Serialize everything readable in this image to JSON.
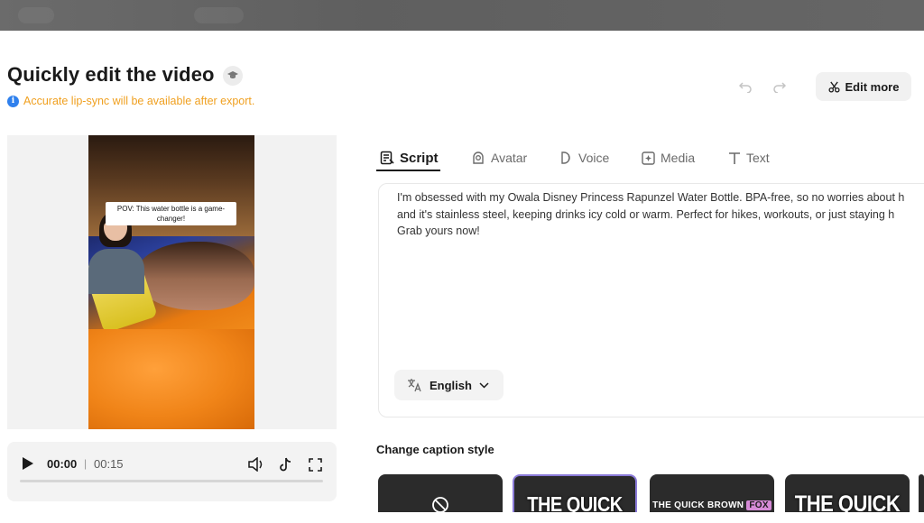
{
  "header": {
    "title": "Quickly edit the video",
    "notice": "Accurate lip-sync will be available after export.",
    "edit_more_label": "Edit more"
  },
  "preview": {
    "overlay_caption": "POV: This water bottle is a game-changer!"
  },
  "player": {
    "current_time": "00:00",
    "separator": "|",
    "total_time": "00:15",
    "progress_fraction": 0
  },
  "tabs": [
    {
      "label": "Script",
      "icon": "script-icon",
      "active": true
    },
    {
      "label": "Avatar",
      "icon": "avatar-icon",
      "active": false
    },
    {
      "label": "Voice",
      "icon": "voice-icon",
      "active": false
    },
    {
      "label": "Media",
      "icon": "media-icon",
      "active": false
    },
    {
      "label": "Text",
      "icon": "text-icon",
      "active": false
    }
  ],
  "script": {
    "lines": [
      "I'm obsessed with my Owala Disney Princess Rapunzel Water Bottle. BPA-free, so no worries about h",
      "and it's stainless steel, keeping drinks icy cold or warm. Perfect for hikes, workouts, or just staying h",
      "Grab yours now!"
    ],
    "language": "English"
  },
  "caption_style": {
    "heading": "Change caption style",
    "cards": [
      {
        "type": "none",
        "icon": "no-caption-icon"
      },
      {
        "type": "preset",
        "text": "THE QUICK",
        "selected": true
      },
      {
        "type": "preset",
        "text": "THE QUICK BROWN",
        "highlight": "FOX"
      },
      {
        "type": "preset",
        "text": "THE QUICK"
      }
    ]
  },
  "colors": {
    "notice": "#f0a020",
    "info": "#2f80ed",
    "selected_border": "#8a7ad8"
  }
}
